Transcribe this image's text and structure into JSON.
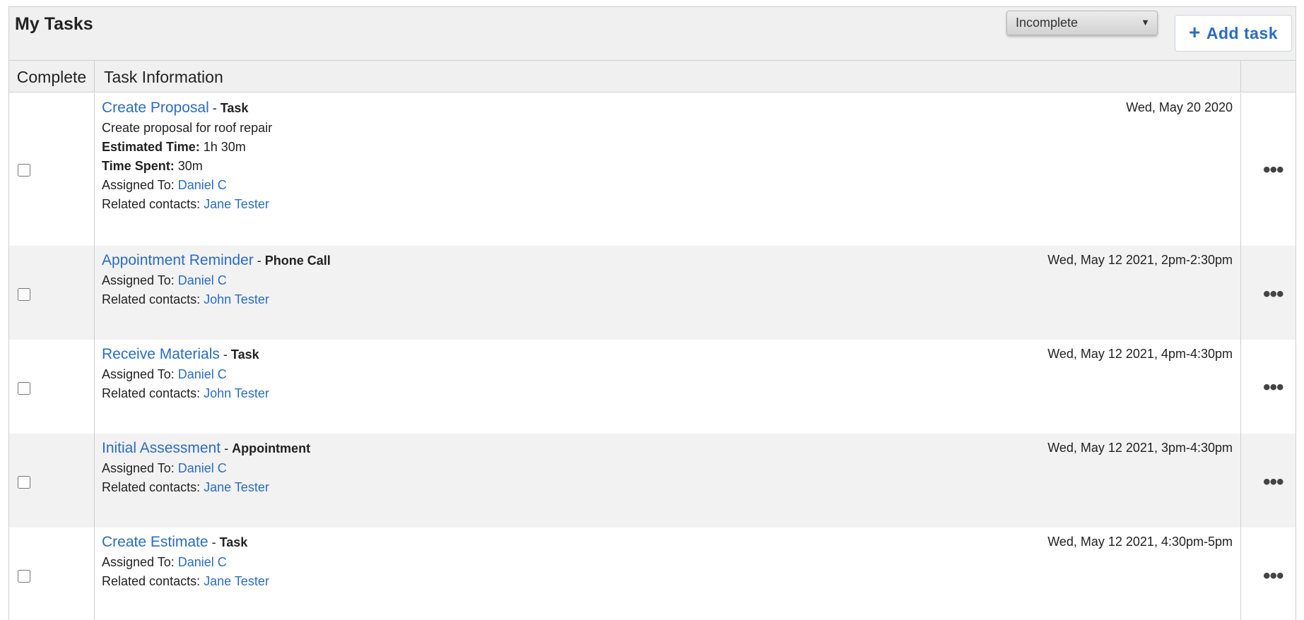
{
  "panel": {
    "title": "My Tasks",
    "filter": {
      "selected": "Incomplete",
      "caret": "▼"
    },
    "add_task": {
      "label": "Add task",
      "icon": "plus-icon",
      "plus": "+"
    }
  },
  "columns": {
    "complete": "Complete",
    "info": "Task Information"
  },
  "labels": {
    "assigned_to": "Assigned To: ",
    "related_contacts": "Related contacts: ",
    "estimated_time": "Estimated Time:",
    "time_spent": "Time Spent:",
    "separator": " - ",
    "more": "•••"
  },
  "tasks": [
    {
      "title": "Create Proposal",
      "type": "Task",
      "description": "Create proposal for roof repair",
      "estimated_time": " 1h 30m",
      "time_spent": " 30m",
      "assigned_to": "Daniel C",
      "related_contacts": "Jane Tester",
      "date": "Wed, May 20 2020",
      "completed": false
    },
    {
      "title": "Appointment Reminder",
      "type": "Phone Call",
      "assigned_to": "Daniel C",
      "related_contacts": "John Tester",
      "date": "Wed, May 12 2021, 2pm-2:30pm",
      "completed": false
    },
    {
      "title": "Receive Materials",
      "type": "Task",
      "assigned_to": "Daniel C",
      "related_contacts": "John Tester",
      "date": "Wed, May 12 2021, 4pm-4:30pm",
      "completed": false
    },
    {
      "title": "Initial Assessment",
      "type": "Appointment",
      "assigned_to": "Daniel C",
      "related_contacts": "Jane Tester",
      "date": "Wed, May 12 2021, 3pm-4:30pm",
      "completed": false
    },
    {
      "title": "Create Estimate",
      "type": "Task",
      "assigned_to": "Daniel C",
      "related_contacts": "Jane Tester",
      "date": "Wed, May 12 2021, 4:30pm-5pm",
      "completed": false
    }
  ],
  "colors": {
    "link": "#2b6cc4",
    "header_bg": "#f0f0f0",
    "alt_row_bg": "#f2f2f2",
    "border": "#cfcfcf"
  }
}
